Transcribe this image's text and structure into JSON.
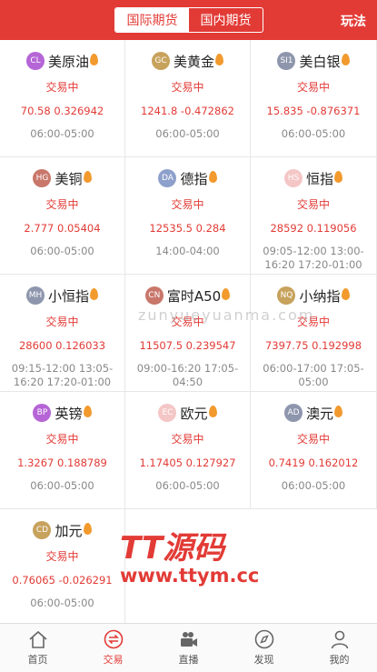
{
  "header": {
    "tabs": [
      {
        "label": "国际期货",
        "active": true
      },
      {
        "label": "国内期货",
        "active": false
      }
    ],
    "right_action": "玩法"
  },
  "products": [
    {
      "badge": "CL",
      "badge_color": "#b565d6",
      "name": "美原油",
      "status": "交易中",
      "price": "70.58 0.326942",
      "time": "06:00-05:00"
    },
    {
      "badge": "GC",
      "badge_color": "#c7a25c",
      "name": "美黄金",
      "status": "交易中",
      "price": "1241.8 -0.472862",
      "time": "06:00-05:00"
    },
    {
      "badge": "SI1",
      "badge_color": "#8e96ad",
      "name": "美白银",
      "status": "交易中",
      "price": "15.835 -0.876371",
      "time": "06:00-05:00"
    },
    {
      "badge": "HG",
      "badge_color": "#c9776b",
      "name": "美铜",
      "status": "交易中",
      "price": "2.777 0.05404",
      "time": "06:00-05:00"
    },
    {
      "badge": "DA",
      "badge_color": "#8da0cb",
      "name": "德指",
      "status": "交易中",
      "price": "12535.5 0.284",
      "time": "14:00-04:00"
    },
    {
      "badge": "HS",
      "badge_color": "#f4c6c6",
      "name": "恒指",
      "status": "交易中",
      "price": "28592 0.119056",
      "time": "09:05-12:00 13:00-16:20 17:20-01:00"
    },
    {
      "badge": "MH",
      "badge_color": "#8e96ad",
      "name": "小恒指",
      "status": "交易中",
      "price": "28600 0.126033",
      "time": "09:15-12:00 13:05-16:20 17:20-01:00"
    },
    {
      "badge": "CN",
      "badge_color": "#c9776b",
      "name": "富时A50",
      "status": "交易中",
      "price": "11507.5 0.239547",
      "time": "09:00-16:20 17:05-04:50"
    },
    {
      "badge": "NQ",
      "badge_color": "#c7a25c",
      "name": "小纳指",
      "status": "交易中",
      "price": "7397.75 0.192998",
      "time": "06:00-17:00 17:05-05:00"
    },
    {
      "badge": "BP",
      "badge_color": "#b565d6",
      "name": "英镑",
      "status": "交易中",
      "price": "1.3267 0.188789",
      "time": "06:00-05:00"
    },
    {
      "badge": "EC",
      "badge_color": "#f4c6c6",
      "name": "欧元",
      "status": "交易中",
      "price": "1.17405 0.127927",
      "time": "06:00-05:00"
    },
    {
      "badge": "AD",
      "badge_color": "#8e96ad",
      "name": "澳元",
      "status": "交易中",
      "price": "0.7419 0.162012",
      "time": "06:00-05:00"
    },
    {
      "badge": "CD",
      "badge_color": "#c7a25c",
      "name": "加元",
      "status": "交易中",
      "price": "0.76065 -0.026291",
      "time": "06:00-05:00"
    }
  ],
  "watermark": "zunyueyuanma.com",
  "brand": {
    "logo": "TT源码",
    "url": "www.ttym.cc"
  },
  "tabbar": [
    {
      "label": "首页",
      "icon": "home-icon",
      "active": false
    },
    {
      "label": "交易",
      "icon": "exchange-icon",
      "active": true
    },
    {
      "label": "直播",
      "icon": "camera-icon",
      "active": false
    },
    {
      "label": "发现",
      "icon": "compass-icon",
      "active": false
    },
    {
      "label": "我的",
      "icon": "user-icon",
      "active": false
    }
  ],
  "colors": {
    "accent": "#e23b36",
    "flame": "#f29a2e",
    "muted": "#888888"
  }
}
